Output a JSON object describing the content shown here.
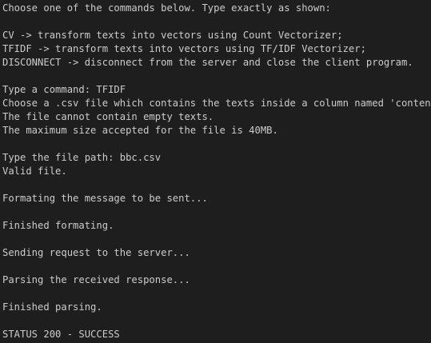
{
  "terminal": {
    "lines": [
      "Choose one of the commands below. Type exactly as shown:",
      "",
      "CV -> transform texts into vectors using Count Vectorizer;",
      "TFIDF -> transform texts into vectors using TF/IDF Vectorizer;",
      "DISCONNECT -> disconnect from the server and close the client program.",
      "",
      "Type a command: TFIDF",
      "Choose a .csv file which contains the texts inside a column named 'content'.",
      "The file cannot contain empty texts.",
      "The maximum size accepted for the file is 40MB.",
      "",
      "Type the file path: bbc.csv",
      "Valid file.",
      "",
      "Formating the message to be sent...",
      "",
      "Finished formating.",
      "",
      "Sending request to the server...",
      "",
      "Parsing the received response...",
      "",
      "Finished parsing.",
      "",
      "STATUS 200 - SUCCESS"
    ]
  }
}
